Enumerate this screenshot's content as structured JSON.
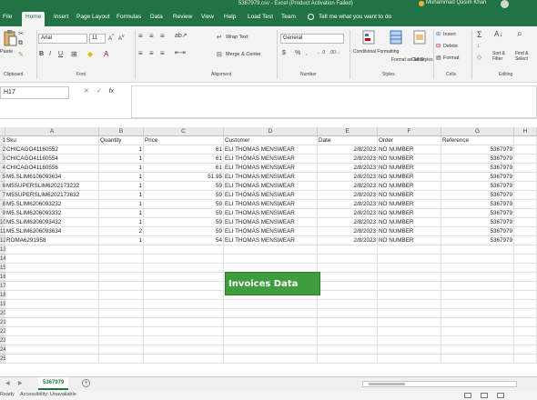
{
  "window": {
    "title": "5367979.csv - Excel (Product Activation Failed)",
    "user": "Muhammad Qasim Khan"
  },
  "menu": {
    "tabs": [
      "File",
      "Home",
      "Insert",
      "Page Layout",
      "Formulas",
      "Data",
      "Review",
      "View",
      "Help",
      "Load Test",
      "Team"
    ],
    "active": "Home",
    "tell_me": "Tell me what you want to do"
  },
  "ribbon": {
    "clipboard": {
      "paste": "Paste",
      "label": "Clipboard"
    },
    "font": {
      "name": "Arial",
      "size": "11",
      "label": "Font"
    },
    "alignment": {
      "wrap": "Wrap Text",
      "merge": "Merge & Center",
      "label": "Alignment"
    },
    "number": {
      "format": "General",
      "label": "Number"
    },
    "styles": {
      "conditional": "Conditional Formatting",
      "format_table": "Format as Table",
      "cell_styles": "Cell Styles",
      "label": "Styles"
    },
    "cells": {
      "insert": "Insert",
      "delete": "Delete",
      "format": "Format",
      "label": "Cells"
    },
    "editing": {
      "sort": "Sort & Filter",
      "find": "Find & Select",
      "label": "Editing"
    }
  },
  "formula_bar": {
    "name_box": "H17",
    "fx": "fx",
    "value": ""
  },
  "columns": [
    "A",
    "B",
    "C",
    "D",
    "E",
    "F",
    "G",
    "H"
  ],
  "rows": [
    {
      "n": "1",
      "A": "Sku",
      "B": "Quantity",
      "C": "Price",
      "D": "Customer",
      "E": "Date",
      "F": "Order",
      "G": "Reference"
    },
    {
      "n": "2",
      "A": "CHICAGO41160552",
      "B": "1",
      "C": "61",
      "D": "ELI THOMAS MENSWEAR",
      "E": "2/8/2023",
      "F": "NO NUMBER",
      "G": "5367979"
    },
    {
      "n": "3",
      "A": "CHICAGO41160554",
      "B": "1",
      "C": "61",
      "D": "ELI THOMAS MENSWEAR",
      "E": "2/8/2023",
      "F": "NO NUMBER",
      "G": "5367979"
    },
    {
      "n": "4",
      "A": "CHICAGO41160556",
      "B": "1",
      "C": "61",
      "D": "ELI THOMAS MENSWEAR",
      "E": "2/8/2023",
      "F": "NO NUMBER",
      "G": "5367979"
    },
    {
      "n": "5",
      "A": "M5.SLIM6106093634",
      "B": "1",
      "C": "51.95",
      "D": "ELI THOMAS MENSWEAR",
      "E": "2/8/2023",
      "F": "NO NUMBER",
      "G": "5367979"
    },
    {
      "n": "6",
      "A": "M5SUPERSLIM6202173232",
      "B": "1",
      "C": "59",
      "D": "ELI THOMAS MENSWEAR",
      "E": "2/8/2023",
      "F": "NO NUMBER",
      "G": "5367979"
    },
    {
      "n": "7",
      "A": "M5SUPERSLIM6202173632",
      "B": "1",
      "C": "59",
      "D": "ELI THOMAS MENSWEAR",
      "E": "2/8/2023",
      "F": "NO NUMBER",
      "G": "5367979"
    },
    {
      "n": "8",
      "A": "M5.SLIM6206093232",
      "B": "1",
      "C": "59",
      "D": "ELI THOMAS MENSWEAR",
      "E": "2/8/2023",
      "F": "NO NUMBER",
      "G": "5367979"
    },
    {
      "n": "9",
      "A": "M5.SLIM6206093332",
      "B": "1",
      "C": "59",
      "D": "ELI THOMAS MENSWEAR",
      "E": "2/8/2023",
      "F": "NO NUMBER",
      "G": "5367979"
    },
    {
      "n": "10",
      "A": "M5.SLIM6206093432",
      "B": "1",
      "C": "59",
      "D": "ELI THOMAS MENSWEAR",
      "E": "2/8/2023",
      "F": "NO NUMBER",
      "G": "5367979"
    },
    {
      "n": "11",
      "A": "M5.SLIM6206093634",
      "B": "2",
      "C": "59",
      "D": "ELI THOMAS MENSWEAR",
      "E": "2/8/2023",
      "F": "NO NUMBER",
      "G": "5367979"
    },
    {
      "n": "12",
      "A": "ROMA6291958",
      "B": "1",
      "C": "54",
      "D": "ELI THOMAS MENSWEAR",
      "E": "2/8/2023",
      "F": "NO NUMBER",
      "G": "5367979"
    }
  ],
  "empty_rows": [
    "13",
    "14",
    "15",
    "16",
    "17",
    "18",
    "19",
    "20",
    "21",
    "22",
    "23",
    "24",
    "25"
  ],
  "badge": "Invoices Data",
  "sheet": {
    "tab": "5367979",
    "add": "+"
  },
  "status": {
    "ready": "Ready",
    "accessibility": "Accessibility: Unavailable"
  }
}
